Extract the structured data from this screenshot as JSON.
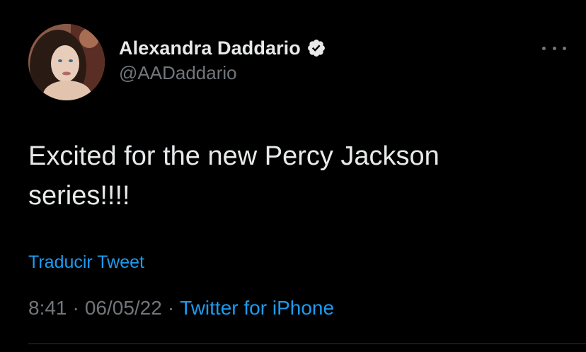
{
  "author": {
    "display_name": "Alexandra Daddario",
    "handle": "@AADaddario",
    "verified": true,
    "avatar": "profile-photo"
  },
  "tweet": {
    "text_line1": "Excited for the new Percy Jackson",
    "text_line2": "series!!!!",
    "translate_label": "Traducir Tweet",
    "time": "8:41",
    "separator": "·",
    "date": "06/05/22",
    "source": "Twitter for iPhone"
  },
  "icons": {
    "verified": "verified-badge-icon",
    "more": "more-options-icon"
  },
  "colors": {
    "background": "#000000",
    "text": "#e7e9ea",
    "secondary": "#71767b",
    "link": "#1d9bf0"
  }
}
